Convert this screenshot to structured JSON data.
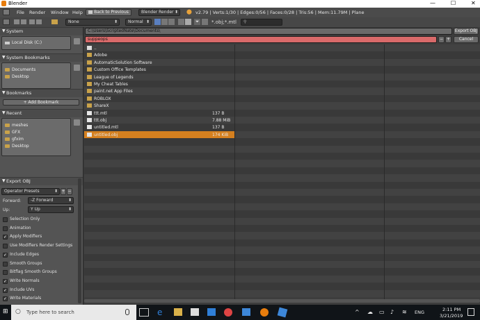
{
  "window": {
    "title": "Blender",
    "min": "—",
    "max": "☐",
    "close": "✕"
  },
  "menu": {
    "items": [
      "File",
      "Render",
      "Window",
      "Help"
    ],
    "back": "Back to Previous",
    "engine": "Blender Render",
    "stats": "v2.79 | Verts:1/30 | Edges:0/56 | Faces:0/28 | Tris:56 | Mem:11.79M | Plane"
  },
  "toolbar": {
    "display_mode": "None",
    "sort": "Normal",
    "filter": "*.obj;*.mtl"
  },
  "path": {
    "directory": "C:\\Users\\ScriptedNate\\Documents\\",
    "filename": "suppeops",
    "export_label": "Export OBJ",
    "cancel_label": "Cancel"
  },
  "sidebar": {
    "system_header": "System",
    "system_items": [
      "Local Disk (C:)"
    ],
    "bookmarks_sys_header": "System Bookmarks",
    "bookmarks_sys_items": [
      "Documents",
      "Desktop"
    ],
    "bookmarks_header": "Bookmarks",
    "add_bookmark": "Add Bookmark",
    "recent_header": "Recent",
    "recent_items": [
      "meshes",
      "GFX",
      "gfxim",
      "Desktop"
    ],
    "export_header": "Export OBJ",
    "operator_presets": "Operator Presets",
    "forward_label": "Forward:",
    "forward_value": "-Z Forward",
    "up_label": "Up:",
    "up_value": "Y Up",
    "options": [
      {
        "label": "Selection Only",
        "checked": false
      },
      {
        "label": "Animation",
        "checked": false
      },
      {
        "label": "Apply Modifiers",
        "checked": true
      },
      {
        "label": "Use Modifiers Render Settings",
        "checked": false
      },
      {
        "label": "Include Edges",
        "checked": true
      },
      {
        "label": "Smooth Groups",
        "checked": false
      },
      {
        "label": "Bitflag Smooth Groups",
        "checked": false
      },
      {
        "label": "Write Normals",
        "checked": true
      },
      {
        "label": "Include UVs",
        "checked": true
      },
      {
        "label": "Write Materials",
        "checked": true
      }
    ]
  },
  "files": {
    "parent": "..",
    "entries": [
      {
        "name": "Adobe",
        "type": "folder",
        "size": ""
      },
      {
        "name": "AutomaticSolution Software",
        "type": "folder",
        "size": ""
      },
      {
        "name": "Custom Office Templates",
        "type": "folder",
        "size": ""
      },
      {
        "name": "League of Legends",
        "type": "folder",
        "size": ""
      },
      {
        "name": "My Cheat Tables",
        "type": "folder",
        "size": ""
      },
      {
        "name": "paint.net App Files",
        "type": "folder",
        "size": ""
      },
      {
        "name": "ROBLOX",
        "type": "folder",
        "size": ""
      },
      {
        "name": "ShareX",
        "type": "folder",
        "size": ""
      },
      {
        "name": "ttt.mtl",
        "type": "file",
        "size": "137 B"
      },
      {
        "name": "ttt.obj",
        "type": "file",
        "size": "7.88 MiB"
      },
      {
        "name": "untitled.mtl",
        "type": "file",
        "size": "137 B"
      },
      {
        "name": "untitled.obj",
        "type": "file",
        "size": "174 KiB",
        "selected": true
      }
    ]
  },
  "taskbar": {
    "search_placeholder": "Type here to search",
    "lang": "ENG",
    "time": "2:11 PM",
    "date": "3/21/2019"
  },
  "colors": {
    "accent_selected": "#d5801f",
    "filename_field": "#d96a6a",
    "folder": "#c9a24a"
  }
}
